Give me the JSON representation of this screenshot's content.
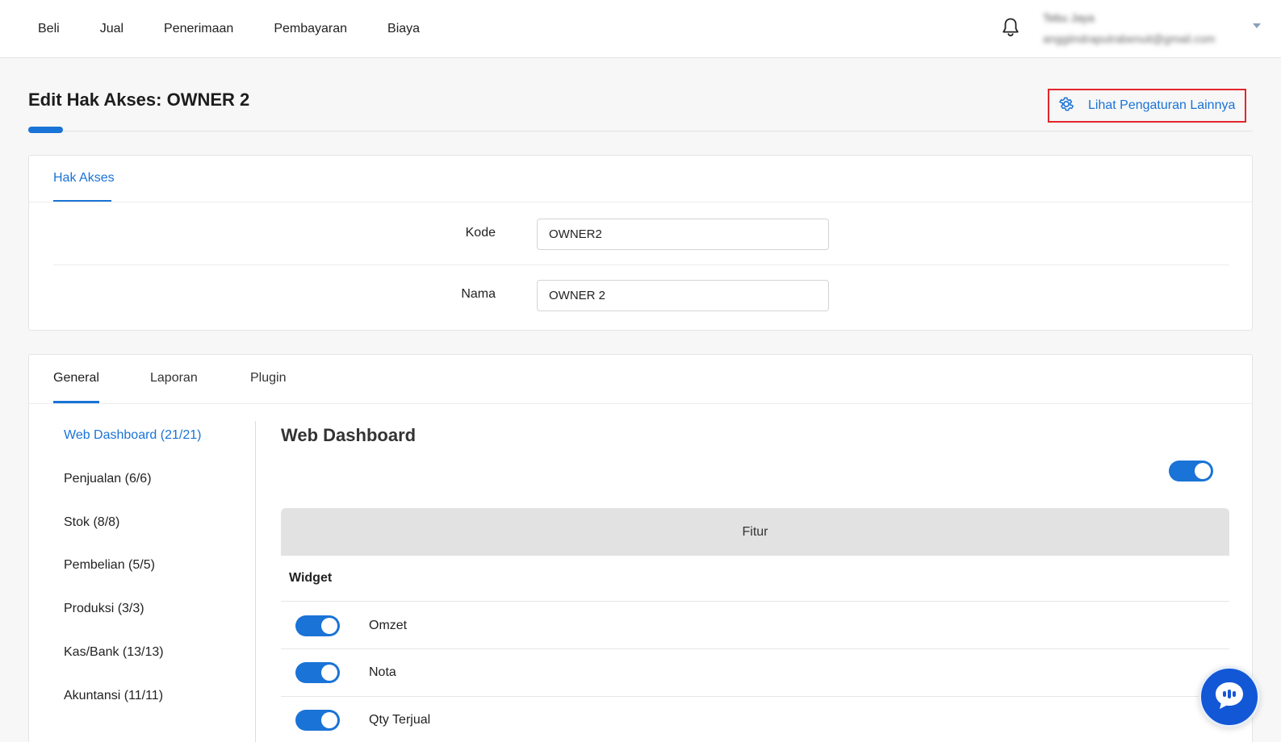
{
  "nav": {
    "items": [
      "Beli",
      "Jual",
      "Penerimaan",
      "Pembayaran",
      "Biaya"
    ]
  },
  "user": {
    "name": "Tebu Jaya",
    "email": "anggiindraputrabenuit@gmail.com"
  },
  "page": {
    "title": "Edit Hak Akses: OWNER 2",
    "settings_link": "Lihat Pengaturan Lainnya"
  },
  "access": {
    "tab": "Hak Akses",
    "kode_label": "Kode",
    "kode_value": "OWNER2",
    "nama_label": "Nama",
    "nama_value": "OWNER 2"
  },
  "permissions": {
    "tabs": [
      "General",
      "Laporan",
      "Plugin"
    ],
    "active_tab": "General",
    "sidebar": [
      "Web Dashboard (21/21)",
      "Penjualan (6/6)",
      "Stok (8/8)",
      "Pembelian (5/5)",
      "Produksi (3/3)",
      "Kas/Bank (13/13)",
      "Akuntansi (11/11)"
    ],
    "section_title": "Web Dashboard",
    "master_toggle": true,
    "table_header": "Fitur",
    "group": "Widget",
    "rows": [
      {
        "label": "Omzet",
        "enabled": true
      },
      {
        "label": "Nota",
        "enabled": true
      },
      {
        "label": "Qty Terjual",
        "enabled": true
      }
    ]
  },
  "colors": {
    "accent": "#1a73d6",
    "highlight_border": "#e3262b",
    "chat_button": "#1257d6"
  },
  "icons": [
    "bell-icon",
    "gear-icon",
    "chevron-down-icon",
    "chat-icon"
  ]
}
